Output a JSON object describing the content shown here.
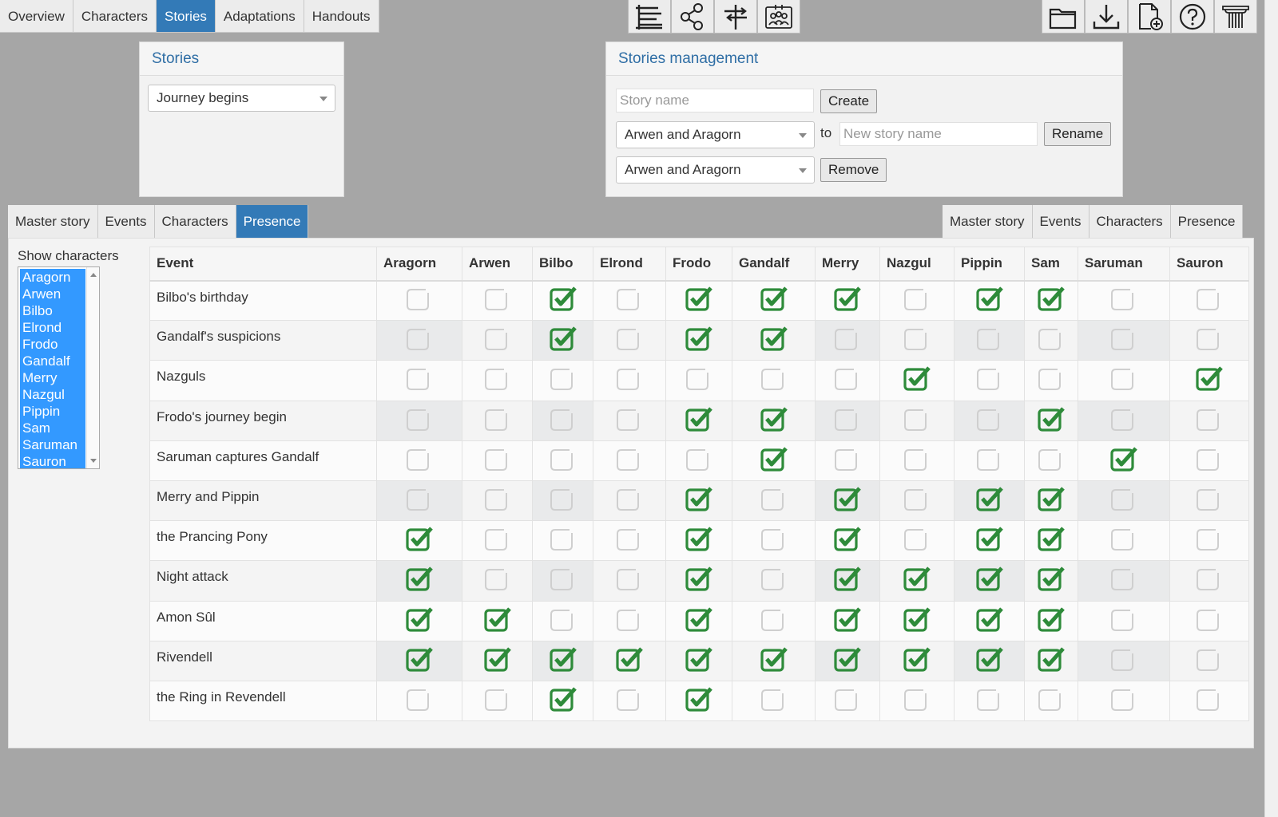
{
  "nav": {
    "tabs": [
      {
        "label": "Overview",
        "active": false
      },
      {
        "label": "Characters",
        "active": false
      },
      {
        "label": "Stories",
        "active": true
      },
      {
        "label": "Adaptations",
        "active": false
      },
      {
        "label": "Handouts",
        "active": false
      }
    ]
  },
  "toolbar": {
    "left_icons": [
      "timeline-icon",
      "share-network-icon",
      "signpost-icon",
      "group-roster-icon"
    ],
    "right_icons": [
      "open-folder-icon",
      "download-icon",
      "new-file-icon",
      "help-icon",
      "column-pillar-icon"
    ]
  },
  "stories_panel": {
    "title": "Stories",
    "selected_story": "Journey begins"
  },
  "management_panel": {
    "title": "Stories management",
    "story_name_placeholder": "Story name",
    "create_label": "Create",
    "rename_select": "Arwen and Aragorn",
    "to_label": "to",
    "new_name_placeholder": "New story name",
    "rename_label": "Rename",
    "remove_select": "Arwen and Aragorn",
    "remove_label": "Remove"
  },
  "left_subtabs": [
    {
      "label": "Master story",
      "active": false
    },
    {
      "label": "Events",
      "active": false
    },
    {
      "label": "Characters",
      "active": false
    },
    {
      "label": "Presence",
      "active": true
    }
  ],
  "right_subtabs": [
    {
      "label": "Master story",
      "active": false
    },
    {
      "label": "Events",
      "active": false
    },
    {
      "label": "Characters",
      "active": false
    },
    {
      "label": "Presence",
      "active": false
    }
  ],
  "presence": {
    "show_label": "Show characters",
    "characters": [
      "Aragorn",
      "Arwen",
      "Bilbo",
      "Elrond",
      "Frodo",
      "Gandalf",
      "Merry",
      "Nazgul",
      "Pippin",
      "Sam",
      "Saruman",
      "Sauron"
    ],
    "event_header": "Event",
    "rows": [
      {
        "event": "Bilbo's birthday",
        "present": [
          0,
          0,
          1,
          0,
          1,
          1,
          1,
          0,
          1,
          1,
          0,
          0
        ]
      },
      {
        "event": "Gandalf's suspicions",
        "present": [
          0,
          0,
          1,
          0,
          1,
          1,
          0,
          0,
          0,
          0,
          0,
          0
        ]
      },
      {
        "event": "Nazguls",
        "present": [
          0,
          0,
          0,
          0,
          0,
          0,
          0,
          1,
          0,
          0,
          0,
          1
        ]
      },
      {
        "event": "Frodo's journey begin",
        "present": [
          0,
          0,
          0,
          0,
          1,
          1,
          0,
          0,
          0,
          1,
          0,
          0
        ]
      },
      {
        "event": "Saruman captures Gandalf",
        "present": [
          0,
          0,
          0,
          0,
          0,
          1,
          0,
          0,
          0,
          0,
          1,
          0
        ]
      },
      {
        "event": "Merry and Pippin",
        "present": [
          0,
          0,
          0,
          0,
          1,
          0,
          1,
          0,
          1,
          1,
          0,
          0
        ]
      },
      {
        "event": "the Prancing Pony",
        "present": [
          1,
          0,
          0,
          0,
          1,
          0,
          1,
          0,
          1,
          1,
          0,
          0
        ]
      },
      {
        "event": "Night attack",
        "present": [
          1,
          0,
          0,
          0,
          1,
          0,
          1,
          1,
          1,
          1,
          0,
          0
        ]
      },
      {
        "event": "Amon Sûl",
        "present": [
          1,
          1,
          0,
          0,
          1,
          0,
          1,
          1,
          1,
          1,
          0,
          0
        ]
      },
      {
        "event": "Rivendell",
        "present": [
          1,
          1,
          1,
          1,
          1,
          1,
          1,
          1,
          1,
          1,
          0,
          0
        ]
      },
      {
        "event": "the Ring in Revendell",
        "present": [
          0,
          0,
          1,
          0,
          1,
          0,
          0,
          0,
          0,
          0,
          0,
          0
        ]
      }
    ]
  },
  "colors": {
    "accent": "#337ab7",
    "check_green": "#2e8b3a",
    "unchecked_gray": "#cfcfcf",
    "list_selection": "#3399ff"
  }
}
